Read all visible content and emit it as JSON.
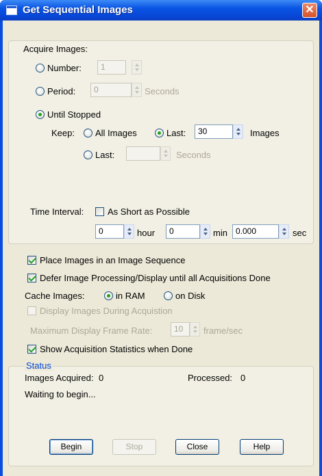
{
  "window": {
    "title": "Get Sequential Images",
    "close_symbol": "✕"
  },
  "acquire": {
    "group_label": "Acquire Images:",
    "number": {
      "label": "Number:",
      "value": "1"
    },
    "period": {
      "label": "Period:",
      "value": "0",
      "unit": "Seconds"
    },
    "until_stopped": {
      "label": "Until Stopped",
      "keep_label": "Keep:",
      "all_images_label": "All Images",
      "last_images": {
        "label": "Last:",
        "value": "30",
        "unit": "Images"
      },
      "last_seconds": {
        "label": "Last:",
        "value": "",
        "unit": "Seconds"
      }
    },
    "time_interval": {
      "label": "Time Interval:",
      "short_label": "As Short as Possible",
      "hour": {
        "value": "0",
        "unit": "hour"
      },
      "min": {
        "value": "0",
        "unit": "min"
      },
      "sec": {
        "value": "0.000",
        "unit": "sec"
      }
    }
  },
  "options": {
    "place_sequence": "Place Images in an Image Sequence",
    "defer_processing": "Defer Image Processing/Display until all Acquisitions Done",
    "cache_label": "Cache Images:",
    "cache_ram": "in RAM",
    "cache_disk": "on Disk",
    "display_during": "Display Images During Acquistion",
    "max_rate_label": "Maximum Display Frame Rate:",
    "max_rate_value": "10",
    "max_rate_unit": "frame/sec",
    "show_stats": "Show Acquisition Statistics when Done"
  },
  "status": {
    "caption": "Status",
    "acquired_label": "Images Acquired:",
    "acquired_value": "0",
    "processed_label": "Processed:",
    "processed_value": "0",
    "message": "Waiting to begin..."
  },
  "buttons": {
    "begin": "Begin",
    "stop": "Stop",
    "close": "Close",
    "help": "Help"
  }
}
